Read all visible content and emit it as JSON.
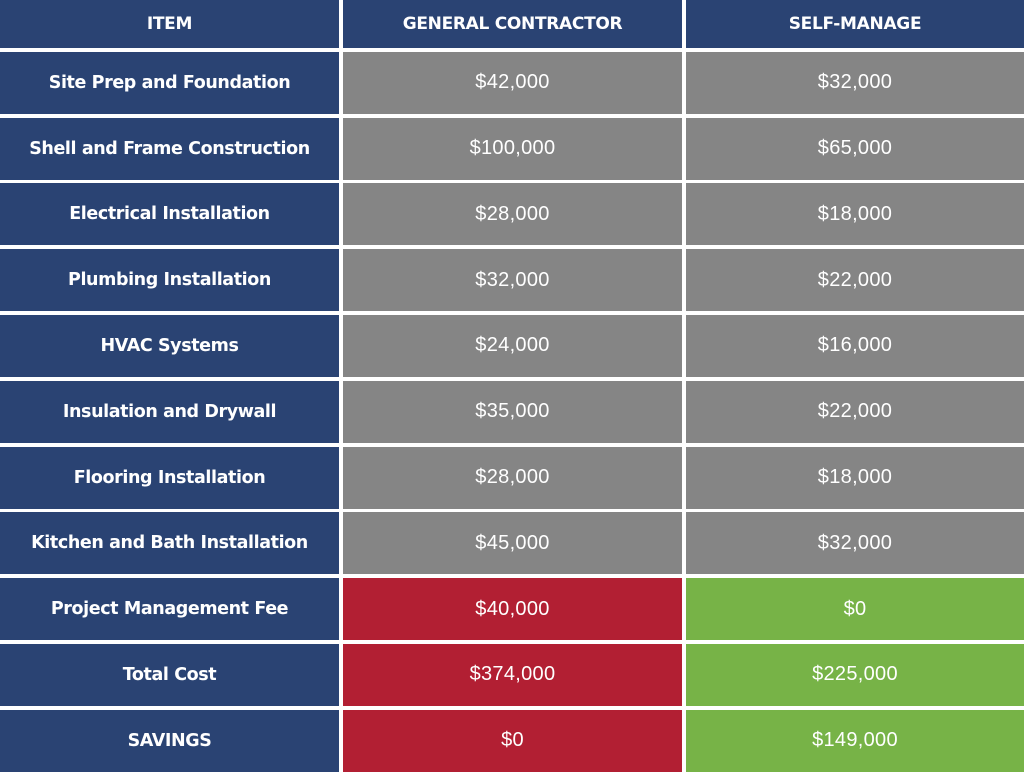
{
  "table": {
    "headers": [
      "ITEM",
      "GENERAL CONTRACTOR",
      "SELF-MANAGE"
    ],
    "rows": [
      {
        "item": "Site Prep and Foundation",
        "general_contractor": "$42,000",
        "self_manage": "$32,000",
        "style": "gray"
      },
      {
        "item": "Shell and Frame Construction",
        "general_contractor": "$100,000",
        "self_manage": "$65,000",
        "style": "gray"
      },
      {
        "item": "Electrical Installation",
        "general_contractor": "$28,000",
        "self_manage": "$18,000",
        "style": "gray"
      },
      {
        "item": "Plumbing Installation",
        "general_contractor": "$32,000",
        "self_manage": "$22,000",
        "style": "gray"
      },
      {
        "item": "HVAC Systems",
        "general_contractor": "$24,000",
        "self_manage": "$16,000",
        "style": "gray"
      },
      {
        "item": "Insulation and Drywall",
        "general_contractor": "$35,000",
        "self_manage": "$22,000",
        "style": "gray"
      },
      {
        "item": "Flooring Installation",
        "general_contractor": "$28,000",
        "self_manage": "$18,000",
        "style": "gray"
      },
      {
        "item": "Kitchen and Bath Installation",
        "general_contractor": "$45,000",
        "self_manage": "$32,000",
        "style": "gray"
      },
      {
        "item": "Project Management Fee",
        "general_contractor": "$40,000",
        "self_manage": "$0",
        "style": "highlight"
      },
      {
        "item": "Total Cost",
        "general_contractor": "$374,000",
        "self_manage": "$225,000",
        "style": "highlight"
      },
      {
        "item": "SAVINGS",
        "general_contractor": "$0",
        "self_manage": "$149,000",
        "style": "highlight"
      }
    ]
  },
  "colors": {
    "header_bg": "#2a4373",
    "item_bg": "#2a4373",
    "neutral_bg": "#858585",
    "contractor_highlight_bg": "#b21f33",
    "self_manage_highlight_bg": "#77b347",
    "text": "#ffffff"
  }
}
